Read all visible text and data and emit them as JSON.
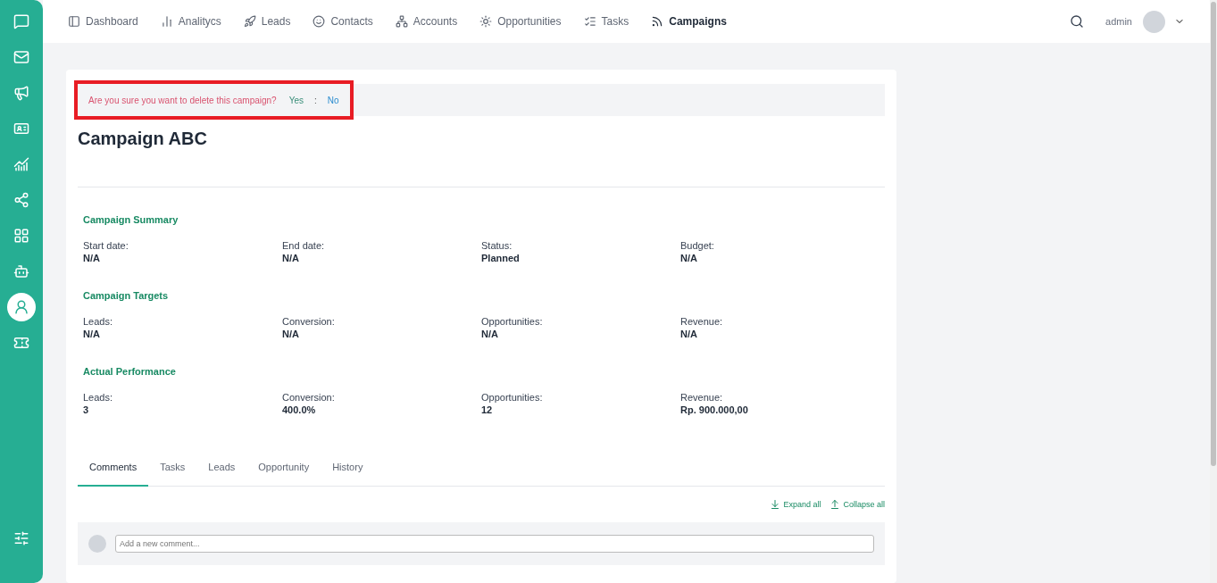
{
  "sidebar": {
    "items": [
      {
        "kind": "chat",
        "selected": false
      },
      {
        "kind": "mail",
        "selected": false
      },
      {
        "kind": "megaphone",
        "selected": false
      },
      {
        "kind": "card",
        "selected": false
      },
      {
        "kind": "chart",
        "selected": false
      },
      {
        "kind": "share",
        "selected": false
      },
      {
        "kind": "grid",
        "selected": false
      },
      {
        "kind": "bot",
        "selected": false
      },
      {
        "kind": "user",
        "selected": true
      },
      {
        "kind": "ticket",
        "selected": false
      }
    ],
    "bottom": {
      "kind": "sliders",
      "selected": false
    }
  },
  "nav": [
    {
      "label": "Dashboard",
      "kind": "dashboard",
      "selected": false
    },
    {
      "label": "Analitycs",
      "kind": "bars",
      "selected": false
    },
    {
      "label": "Leads",
      "kind": "rocket",
      "selected": false
    },
    {
      "label": "Contacts",
      "kind": "smile",
      "selected": false
    },
    {
      "label": "Accounts",
      "kind": "network",
      "selected": false
    },
    {
      "label": "Opportunities",
      "kind": "sun",
      "selected": false
    },
    {
      "label": "Tasks",
      "kind": "list",
      "selected": false
    },
    {
      "label": "Campaigns",
      "kind": "rss",
      "selected": true
    }
  ],
  "user": {
    "name": "admin"
  },
  "confirm": {
    "message": "Are you sure you want to delete this campaign?",
    "yes": "Yes",
    "separator": ":",
    "no": "No",
    "highlighted": true
  },
  "title": "Campaign ABC",
  "sections": [
    {
      "title": "Campaign Summary",
      "fields": [
        {
          "label": "Start date:",
          "value": "N/A"
        },
        {
          "label": "End date:",
          "value": "N/A"
        },
        {
          "label": "Status:",
          "value": "Planned"
        },
        {
          "label": "Budget:",
          "value": "N/A"
        }
      ]
    },
    {
      "title": "Campaign Targets",
      "fields": [
        {
          "label": "Leads:",
          "value": "N/A"
        },
        {
          "label": "Conversion:",
          "value": "N/A"
        },
        {
          "label": "Opportunities:",
          "value": "N/A"
        },
        {
          "label": "Revenue:",
          "value": "N/A"
        }
      ]
    },
    {
      "title": "Actual Performance",
      "fields": [
        {
          "label": "Leads:",
          "value": "3"
        },
        {
          "label": "Conversion:",
          "value": "400.0%"
        },
        {
          "label": "Opportunities:",
          "value": "12"
        },
        {
          "label": "Revenue:",
          "value": "Rp. 900.000,00"
        }
      ]
    }
  ],
  "tabs": [
    {
      "label": "Comments",
      "selected": true
    },
    {
      "label": "Tasks",
      "selected": false
    },
    {
      "label": "Leads",
      "selected": false
    },
    {
      "label": "Opportunity",
      "selected": false
    },
    {
      "label": "History",
      "selected": false
    }
  ],
  "actions": [
    {
      "label": "Expand all",
      "kind": "expand"
    },
    {
      "label": "Collapse all",
      "kind": "collapse"
    }
  ],
  "comment": {
    "placeholder": "Add a new comment..."
  }
}
